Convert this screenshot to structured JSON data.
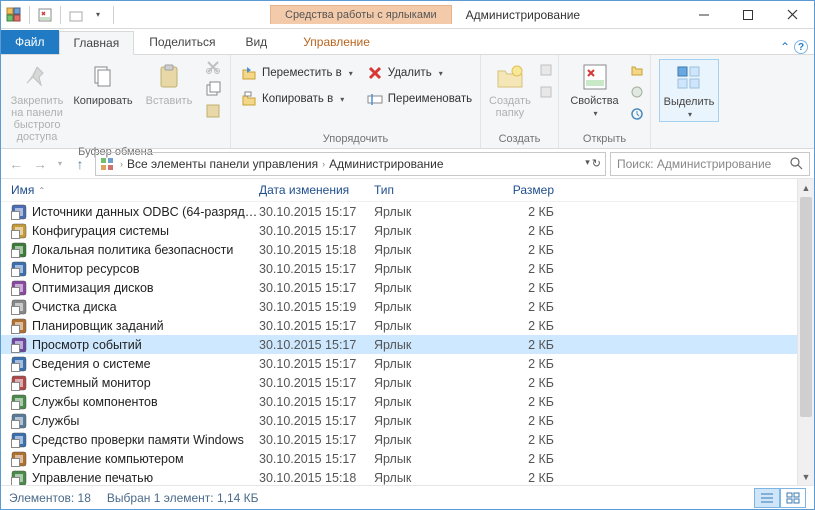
{
  "window": {
    "contextual_tab": "Средства работы с ярлыками",
    "title": "Администрирование"
  },
  "tabs": {
    "file": "Файл",
    "home": "Главная",
    "share": "Поделиться",
    "view": "Вид",
    "manage": "Управление"
  },
  "ribbon": {
    "pin": "Закрепить на панели быстрого доступа",
    "copy": "Копировать",
    "paste": "Вставить",
    "clipboard_group": "Буфер обмена",
    "move_to": "Переместить в",
    "copy_to": "Копировать в",
    "delete": "Удалить",
    "rename": "Переименовать",
    "organize_group": "Упорядочить",
    "new_folder": "Создать папку",
    "new_group": "Создать",
    "properties": "Свойства",
    "open_group": "Открыть",
    "select": "Выделить"
  },
  "address": {
    "root": "Все элементы панели управления",
    "current": "Администрирование"
  },
  "search": {
    "placeholder": "Поиск: Администрирование"
  },
  "columns": {
    "name": "Имя",
    "date": "Дата изменения",
    "type": "Тип",
    "size": "Размер"
  },
  "type_label": "Ярлык",
  "items": [
    {
      "name": "Источники данных ODBC (64-разрядна...",
      "date": "30.10.2015 15:17",
      "size": "2 КБ",
      "color": "#4a6cb3"
    },
    {
      "name": "Конфигурация системы",
      "date": "30.10.2015 15:17",
      "size": "2 КБ",
      "color": "#c59a3b"
    },
    {
      "name": "Локальная политика безопасности",
      "date": "30.10.2015 15:18",
      "size": "2 КБ",
      "color": "#3a7d3a"
    },
    {
      "name": "Монитор ресурсов",
      "date": "30.10.2015 15:17",
      "size": "2 КБ",
      "color": "#3a6fb0"
    },
    {
      "name": "Оптимизация дисков",
      "date": "30.10.2015 15:17",
      "size": "2 КБ",
      "color": "#8a4aa0"
    },
    {
      "name": "Очистка диска",
      "date": "30.10.2015 15:19",
      "size": "2 КБ",
      "color": "#888888"
    },
    {
      "name": "Планировщик заданий",
      "date": "30.10.2015 15:17",
      "size": "2 КБ",
      "color": "#b07030"
    },
    {
      "name": "Просмотр событий",
      "date": "30.10.2015 15:17",
      "size": "2 КБ",
      "color": "#6a4aa0",
      "selected": true
    },
    {
      "name": "Сведения о системе",
      "date": "30.10.2015 15:17",
      "size": "2 КБ",
      "color": "#3a6fb0"
    },
    {
      "name": "Системный монитор",
      "date": "30.10.2015 15:17",
      "size": "2 КБ",
      "color": "#b04a4a"
    },
    {
      "name": "Службы компонентов",
      "date": "30.10.2015 15:17",
      "size": "2 КБ",
      "color": "#4a8a4a"
    },
    {
      "name": "Службы",
      "date": "30.10.2015 15:17",
      "size": "2 КБ",
      "color": "#5a7a9a"
    },
    {
      "name": "Средство проверки памяти Windows",
      "date": "30.10.2015 15:17",
      "size": "2 КБ",
      "color": "#3a6fb0"
    },
    {
      "name": "Управление компьютером",
      "date": "30.10.2015 15:17",
      "size": "2 КБ",
      "color": "#b07030"
    },
    {
      "name": "Управление печатью",
      "date": "30.10.2015 15:18",
      "size": "2 КБ",
      "color": "#4a8a4a"
    }
  ],
  "status": {
    "count": "Элементов: 18",
    "selection": "Выбран 1 элемент: 1,14 КБ"
  }
}
